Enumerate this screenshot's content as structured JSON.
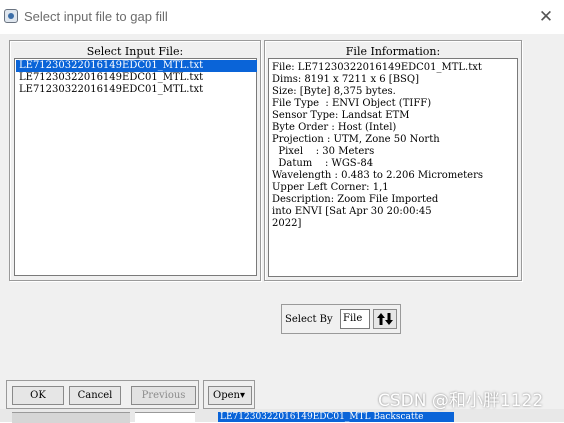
{
  "window": {
    "title": "Select input file to gap fill",
    "close_glyph": "✕",
    "icon": "envi-app-icon"
  },
  "input_panel": {
    "title": "Select Input File:",
    "items": [
      {
        "label": "LE71230322016149EDC01_MTL.txt",
        "selected": true
      },
      {
        "label": "LE71230322016149EDC01_MTL.txt",
        "selected": false
      },
      {
        "label": "LE71230322016149EDC01_MTL.txt",
        "selected": false
      }
    ]
  },
  "info_panel": {
    "title": "File Information:",
    "lines": [
      "File: LE71230322016149EDC01_MTL.txt",
      "Dims: 8191 x 7211 x 6 [BSQ]",
      "Size: [Byte] 8,375 bytes.",
      "File Type  : ENVI Object (TIFF)",
      "Sensor Type: Landsat ETM",
      "Byte Order : Host (Intel)",
      "Projection : UTM, Zone 50 North",
      "  Pixel    : 30 Meters",
      "  Datum    : WGS-84",
      "Wavelength : 0.483 to 2.206 Micrometers",
      "Upper Left Corner: 1,1",
      "Description: Zoom File Imported",
      "into ENVI [Sat Apr 30 20:00:45",
      "2022]"
    ]
  },
  "select_by": {
    "label": "Select By",
    "value": "File",
    "sort_icon": "sort-arrows-icon"
  },
  "buttons": {
    "ok": "OK",
    "cancel": "Cancel",
    "previous": "Previous",
    "open": "Open",
    "open_arrow": "▾"
  },
  "background_fragment": "LE71230322016149EDC01_MTL Backscatte",
  "watermark": "CSDN @和小胖1122"
}
